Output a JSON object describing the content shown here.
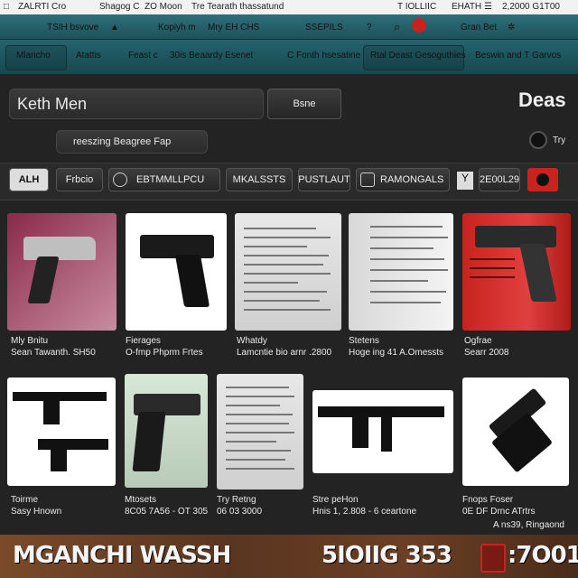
{
  "topbar": {
    "left": "ZALRTI Cro",
    "mid1": "Shagog C",
    "mid2": "ZO Moon",
    "mid3": "Tre Tearath thassatund",
    "right1": "T IOLLIIC",
    "right2": "EHATH",
    "right3": "2,2000 G1T00"
  },
  "nav1": {
    "item1": "TSIH bsvove",
    "item2": "Kopiyh m",
    "item3": "Mry EH CHS",
    "item4": "SSEPILS",
    "right": "Gran Bet"
  },
  "nav2": {
    "tabs": [
      "Mlancho",
      "Atattis",
      "Feast c",
      "30is Beaardy Esenet",
      "C Fonth hsesatine",
      "Rtal Deast Gesoguthies",
      "Beswin and T Garvos"
    ]
  },
  "search": {
    "value": "Keth Men",
    "button": "Bsne"
  },
  "deals": "Deas",
  "subsearch": "reeszing Beagree Fap",
  "toggle_label": "Try",
  "filters": {
    "badge": "ALH",
    "items": [
      "Frbcio",
      "EBTMMLLPCU",
      "MKALSSTS",
      "PUSTLAUT",
      "RAMONGALS"
    ],
    "price": "2E00L29"
  },
  "products_row1": [
    {
      "name": "Mly Bnitu",
      "price": "Sean     Tawanth. SH50"
    },
    {
      "name": "Fierages",
      "price": "O-fmp Phprm Frtes"
    },
    {
      "name": "Whatdy",
      "price": "Lamcntie bio arnr .2800"
    },
    {
      "name": "Stetens",
      "price": "Hoge ing 41 A.Omessts"
    },
    {
      "name": "Ogfrae",
      "price": "Searr 2008"
    }
  ],
  "products_row2": [
    {
      "name": "Toirme",
      "price": "Sasy Hnown"
    },
    {
      "name": "Mtosets",
      "price": "8C05 7A56 - OT 305"
    },
    {
      "name": "Try Retng",
      "price": "06 03 3000"
    },
    {
      "name": "Stre peHon",
      "price": "Hnis 1, 2.808 - 6 ceartone"
    },
    {
      "name": "Fnops Foser",
      "price": "0E DF Drnc ATrtrs"
    }
  ],
  "footnote": "A ns39, Ringaond",
  "footer": {
    "left": "MGANCHI WASSH",
    "right1": "5IOIIG 353",
    "right2": ":7O01"
  },
  "colors": {
    "nav_teal": "#22606a",
    "accent_red": "#c8231e",
    "bg": "#232323"
  }
}
